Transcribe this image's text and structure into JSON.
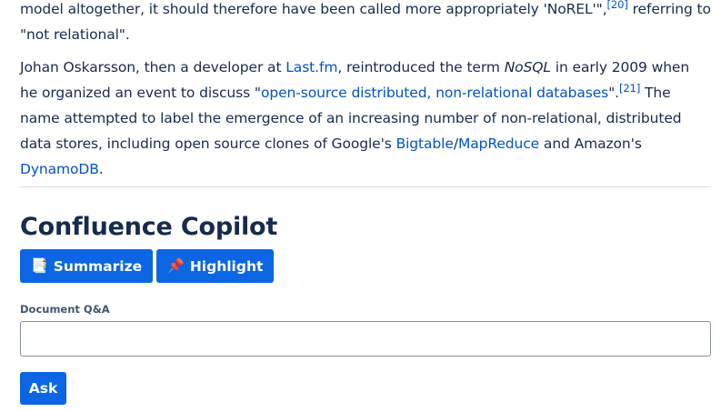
{
  "article": {
    "p1": {
      "text_a": "model altogether, it should therefore have been called more appropriately 'NoREL'\",",
      "ref": "[20]",
      "text_b": " referring to \"not relational\"."
    },
    "p2": {
      "t1": "Johan Oskarsson, then a developer at ",
      "link_lastfm": "Last.fm",
      "t2": ", reintroduced the term ",
      "nosql": "NoSQL",
      "t3": " in early 2009 when he organized an event to discuss \"",
      "link_event": "open-source distributed, non-relational databases",
      "t4": "\".",
      "ref": "[21]",
      "t5": " The name attempted to label the emergence of an increasing number of non-relational, distributed data stores, including open source clones of Google's ",
      "link_bigtable": "Bigtable",
      "slash": "/",
      "link_mapreduce": "MapReduce",
      "t6": " and Amazon's ",
      "link_dynamodb": "DynamoDB",
      "t7": "."
    }
  },
  "copilot": {
    "title": "Confluence Copilot",
    "summarize_label": "Summarize",
    "summarize_icon": "bookmark-tabs-icon",
    "highlight_label": "Highlight",
    "highlight_icon": "pushpin-icon",
    "qa_label": "Document Q&A",
    "qa_value": "",
    "ask_label": "Ask"
  },
  "colors": {
    "accent": "#0c66e4",
    "link": "#0052cc",
    "text": "#172b4d"
  }
}
